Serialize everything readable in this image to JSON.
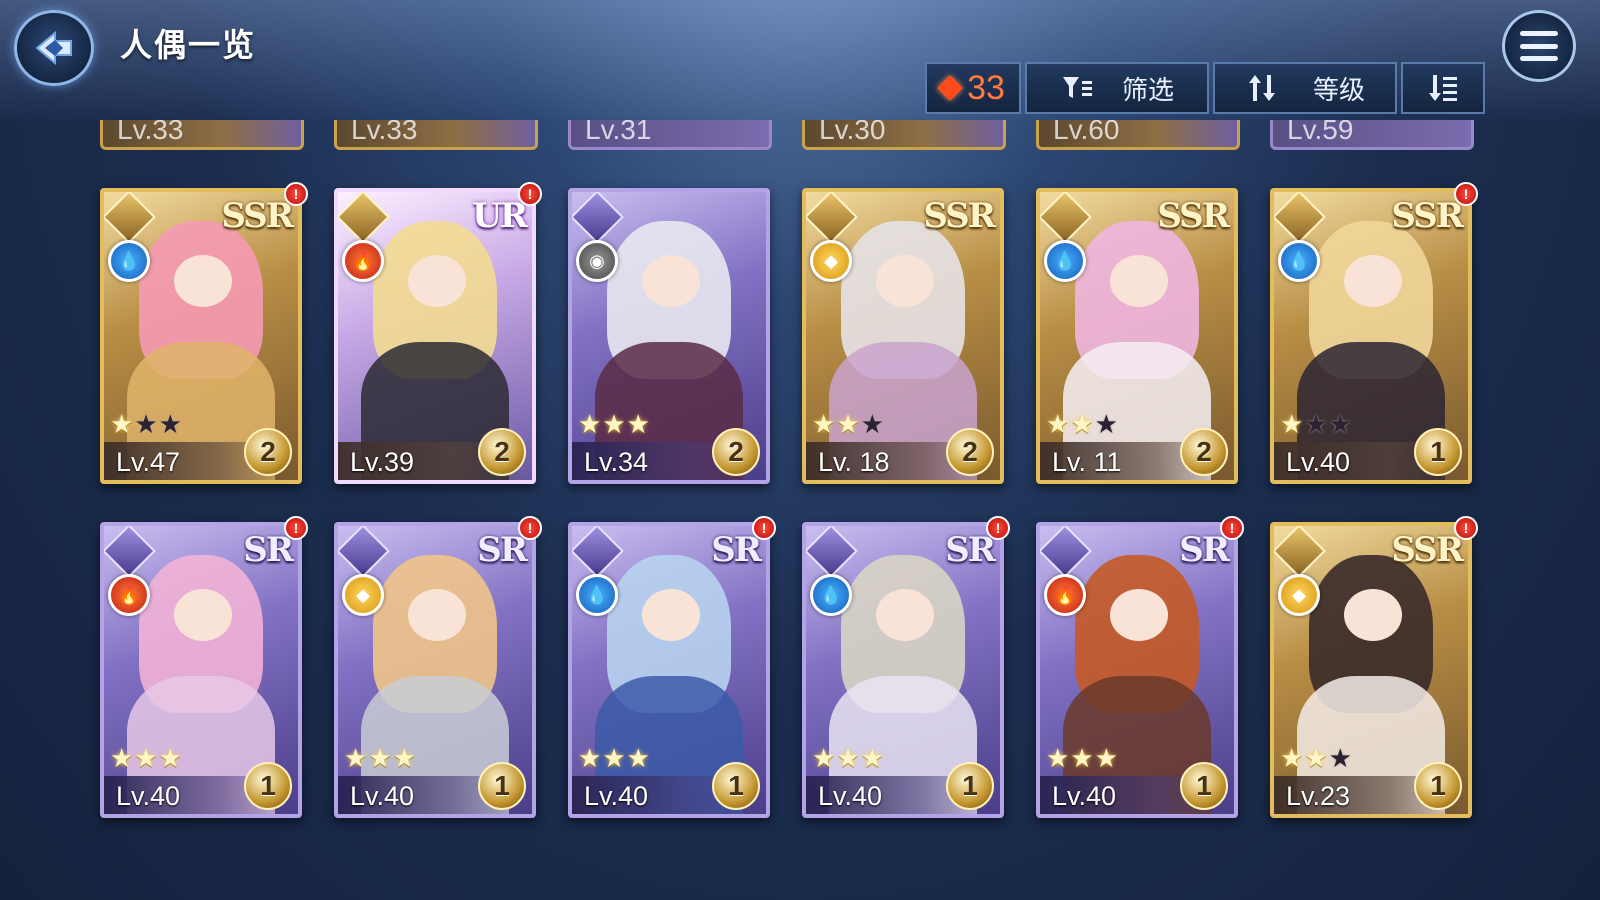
{
  "header": {
    "title": "人偶一览"
  },
  "toolbar": {
    "currency_value": "33",
    "filter_label": "筛选",
    "level_label": "等级",
    "accent": "#ff5a24"
  },
  "partial_row": [
    {
      "level": "Lv.33",
      "style": "gold"
    },
    {
      "level": "Lv.33",
      "style": "gold"
    },
    {
      "level": "Lv.31",
      "style": "purple"
    },
    {
      "level": "Lv.30",
      "style": "gold"
    },
    {
      "level": "Lv.60",
      "style": "gold"
    },
    {
      "level": "Lv.59",
      "style": "purple"
    }
  ],
  "cards": [
    {
      "rarity": "SSR",
      "tier": "ssr",
      "element": "water",
      "stars": 3,
      "stars_on": 1,
      "level": "Lv.47",
      "grade": "2",
      "alert": true,
      "hair": "#f59ab4",
      "body": "#e0b46a"
    },
    {
      "rarity": "UR",
      "tier": "ur",
      "element": "fire",
      "stars": 0,
      "stars_on": 0,
      "level": "Lv.39",
      "grade": "2",
      "alert": true,
      "hair": "#f3dc92",
      "body": "#2b2a33"
    },
    {
      "rarity": "",
      "tier": "sr",
      "element": "dark",
      "stars": 3,
      "stars_on": 3,
      "level": "Lv.34",
      "grade": "2",
      "alert": false,
      "hair": "#e8e8ef",
      "body": "#5a2a45"
    },
    {
      "rarity": "SSR",
      "tier": "ssr",
      "element": "light",
      "stars": 3,
      "stars_on": 2,
      "level": "Lv. 18",
      "grade": "2",
      "alert": false,
      "hair": "#e6e2e6",
      "body": "#c9a3cf"
    },
    {
      "rarity": "SSR",
      "tier": "ssr",
      "element": "water",
      "stars": 3,
      "stars_on": 2,
      "level": "Lv. 11",
      "grade": "2",
      "alert": false,
      "hair": "#f0b6e0",
      "body": "#f6f0f4"
    },
    {
      "rarity": "SSR",
      "tier": "ssr",
      "element": "water",
      "stars": 3,
      "stars_on": 1,
      "level": "Lv.40",
      "grade": "1",
      "alert": true,
      "hair": "#f1d69a",
      "body": "#2b2533"
    },
    {
      "rarity": "SR",
      "tier": "sr",
      "element": "fire",
      "stars": 3,
      "stars_on": 3,
      "level": "Lv.40",
      "grade": "1",
      "alert": true,
      "hair": "#f2b3d7",
      "body": "#e8c8e6"
    },
    {
      "rarity": "SR",
      "tier": "sr",
      "element": "light",
      "stars": 3,
      "stars_on": 3,
      "level": "Lv.40",
      "grade": "1",
      "alert": true,
      "hair": "#efc488",
      "body": "#c9ccd5"
    },
    {
      "rarity": "SR",
      "tier": "sr",
      "element": "water",
      "stars": 3,
      "stars_on": 3,
      "level": "Lv.40",
      "grade": "1",
      "alert": true,
      "hair": "#b8d3f0",
      "body": "#3b5aa8"
    },
    {
      "rarity": "SR",
      "tier": "sr",
      "element": "water",
      "stars": 3,
      "stars_on": 3,
      "level": "Lv.40",
      "grade": "1",
      "alert": true,
      "hair": "#d8d4c4",
      "body": "#e9e4f2"
    },
    {
      "rarity": "SR",
      "tier": "sr",
      "element": "fire",
      "stars": 3,
      "stars_on": 3,
      "level": "Lv.40",
      "grade": "1",
      "alert": true,
      "hair": "#c45a26",
      "body": "#6a3a2a"
    },
    {
      "rarity": "SSR",
      "tier": "ssr",
      "element": "light",
      "stars": 3,
      "stars_on": 2,
      "level": "Lv.23",
      "grade": "1",
      "alert": true,
      "hair": "#3a2a2a",
      "body": "#f4ece8"
    }
  ]
}
